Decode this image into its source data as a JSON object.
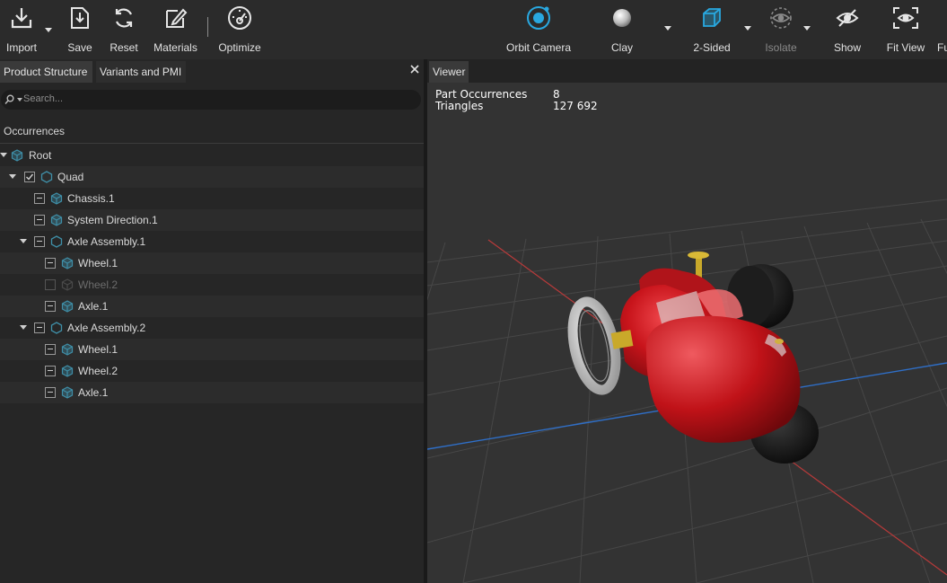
{
  "toolbar": {
    "buttons": [
      {
        "label": "Import"
      },
      {
        "label": "Save"
      },
      {
        "label": "Reset"
      },
      {
        "label": "Materials"
      },
      {
        "label": "Optimize"
      },
      {
        "label": "Orbit Camera"
      },
      {
        "label": "Clay"
      },
      {
        "label": "2-Sided"
      },
      {
        "label": "Isolate"
      },
      {
        "label": "Show"
      },
      {
        "label": "Fit View"
      },
      {
        "label": "Fu"
      }
    ]
  },
  "left_panel": {
    "tabs": [
      {
        "label": "Product Structure",
        "active": true
      },
      {
        "label": "Variants and PMI",
        "active": false
      }
    ],
    "search": {
      "placeholder": "Search..."
    },
    "column_header": "Occurrences",
    "tree": [
      {
        "name": "Root",
        "expanded": true,
        "checkbox": "none",
        "icon": "cube-icon"
      },
      {
        "name": "Quad",
        "expanded": true,
        "checkbox": "checked",
        "icon": "hexagon-icon"
      },
      {
        "name": "Chassis.1",
        "checkbox": "partial",
        "icon": "cube-icon"
      },
      {
        "name": "System Direction.1",
        "checkbox": "partial",
        "icon": "cube-icon"
      },
      {
        "name": "Axle Assembly.1",
        "expanded": true,
        "checkbox": "partial",
        "icon": "hexagon-icon"
      },
      {
        "name": "Wheel.1",
        "checkbox": "partial",
        "icon": "cube-icon"
      },
      {
        "name": "Wheel.2",
        "checkbox": "hidden",
        "icon": "cube-icon",
        "hidden": true
      },
      {
        "name": "Axle.1",
        "checkbox": "partial",
        "icon": "cube-icon"
      },
      {
        "name": "Axle Assembly.2",
        "expanded": true,
        "checkbox": "partial",
        "icon": "hexagon-icon"
      },
      {
        "name": "Wheel.1",
        "checkbox": "partial",
        "icon": "cube-icon"
      },
      {
        "name": "Wheel.2",
        "checkbox": "partial",
        "icon": "cube-icon"
      },
      {
        "name": "Axle.1",
        "checkbox": "partial",
        "icon": "cube-icon"
      }
    ]
  },
  "viewer": {
    "tab_label": "Viewer",
    "stats": [
      {
        "label": "Part Occurrences",
        "value": "8"
      },
      {
        "label": "Triangles",
        "value": "127 692"
      }
    ]
  },
  "colors": {
    "accent": "#29a8e0",
    "icon_teal": "#3f8fa8",
    "axis_x": "#b83a3a",
    "axis_z": "#2f6fc8",
    "body_red": "#c8141b",
    "tire_black": "#141414"
  }
}
